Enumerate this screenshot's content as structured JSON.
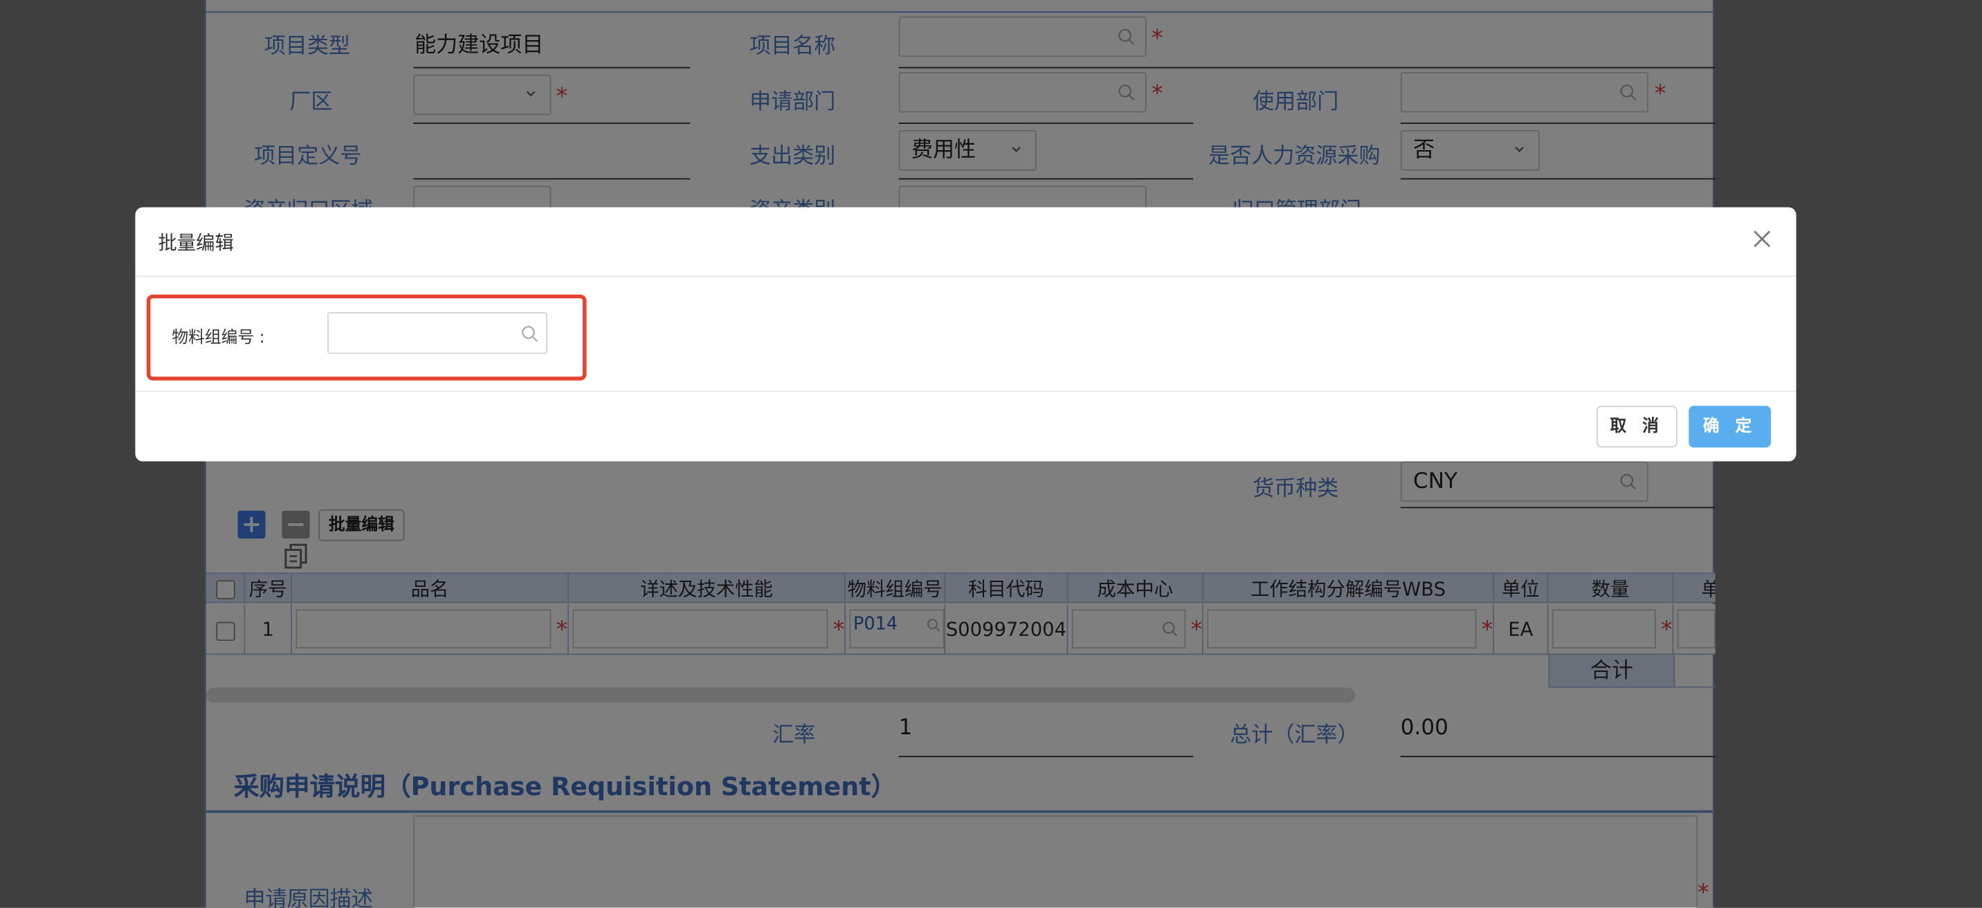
{
  "form": {
    "project_type_label": "项目类型",
    "project_type_value": "能力建设项目",
    "project_name_label": "项目名称",
    "plant_area_label": "厂区",
    "apply_dept_label": "申请部门",
    "use_dept_label": "使用部门",
    "project_def_label": "项目定义号",
    "expense_type_label": "支出类别",
    "expense_type_value": "费用性",
    "hr_purchase_label": "是否人力资源采购",
    "hr_purchase_value": "否",
    "asset_area_label": "资产归口区域",
    "asset_type_label": "资产类别",
    "mgmt_dept_label": "归口管理部门",
    "currency_label": "货币种类",
    "currency_value": "CNY",
    "rate_label": "汇率",
    "rate_value": "1",
    "total_label": "总计（汇率）",
    "total_value": "0.00",
    "batch_edit_button": "批量编辑",
    "reason_label": "申请原因描述",
    "required_mark": "*"
  },
  "table": {
    "headers": [
      "序号",
      "品名",
      "详述及技术性能",
      "物料组编号",
      "科目代码",
      "成本中心",
      "工作结构分解编号WBS",
      "单位",
      "数量",
      "单"
    ],
    "row": {
      "index": "1",
      "material_group": "P014",
      "account_code": "S009972004",
      "unit": "EA"
    },
    "subtotal_label": "合计"
  },
  "section": {
    "statement_title": "采购申请说明（Purchase Requisition Statement）"
  },
  "modal": {
    "title": "批量编辑",
    "field_label": "物料组编号 :",
    "field_value": "",
    "cancel_label": "取 消",
    "confirm_label": "确 定"
  },
  "colors": {
    "label_blue": "#4b79c6",
    "required_red": "#e03d3d",
    "header_bg": "#d6e2f6",
    "confirm_button": "#5aaef0",
    "highlight_border": "#e4432f"
  },
  "icons": [
    "search-icon",
    "chevron-down-icon",
    "close-icon",
    "add-icon",
    "remove-icon",
    "copy-icon"
  ]
}
